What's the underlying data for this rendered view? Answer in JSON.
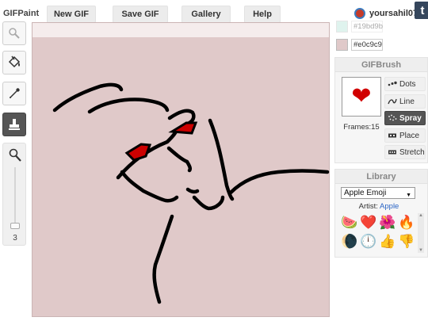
{
  "app": {
    "brand": "GIFPaint"
  },
  "nav": {
    "new_gif": "New GIF",
    "save_gif": "Save GIF",
    "gallery": "Gallery",
    "help": "Help"
  },
  "user": {
    "name": "yoursahil07"
  },
  "tumblr": {
    "label": "t"
  },
  "colors": {
    "primary": "#e0c9c9",
    "primary_hex": "#e0c9c9",
    "secondary": "#19bd9b",
    "secondary_hex": "#19bd9b"
  },
  "tools": [
    {
      "name": "magnifier"
    },
    {
      "name": "paint-bucket"
    },
    {
      "name": "eyedropper"
    },
    {
      "name": "stamp",
      "active": true
    },
    {
      "name": "zoom-pen"
    }
  ],
  "brush_size": {
    "value": "3"
  },
  "gifbrush": {
    "title": "GIFBrush",
    "frames": "Frames:15",
    "modes": [
      {
        "label": "Dots",
        "icon": "dots-icon"
      },
      {
        "label": "Line",
        "icon": "line-icon"
      },
      {
        "label": "Spray",
        "icon": "spray-icon",
        "active": true
      },
      {
        "label": "Place",
        "icon": "place-icon"
      },
      {
        "label": "Stretch",
        "icon": "stretch-icon"
      }
    ]
  },
  "library": {
    "title": "Library",
    "selected": "Apple Emoji",
    "artist_label": "Artist:",
    "artist_name": "Apple",
    "emojis": [
      "🍉",
      "❤️",
      "🌺",
      "🔥",
      "🌘",
      "🕛",
      "👍",
      "👎"
    ]
  }
}
